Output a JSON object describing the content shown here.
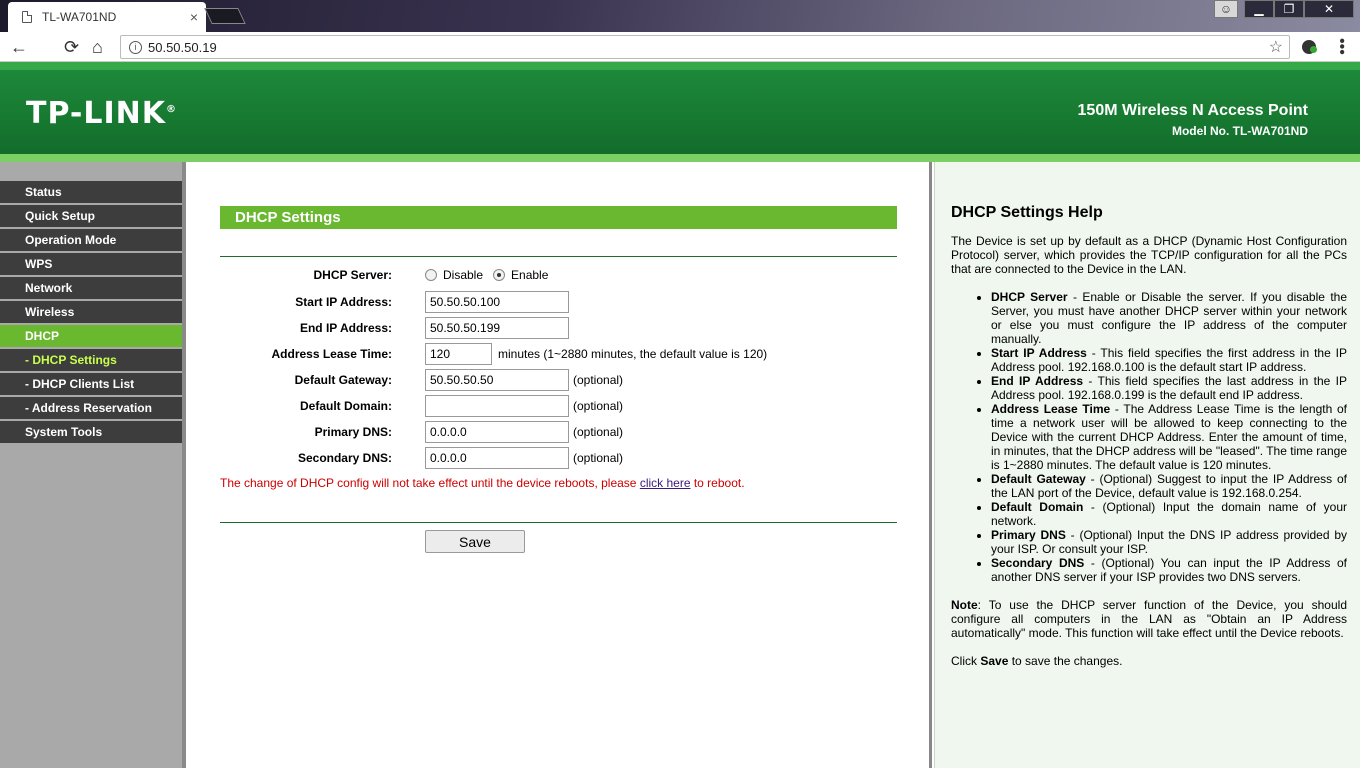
{
  "browser": {
    "tab_title": "TL-WA701ND",
    "tab_close": "×",
    "url": "50.50.50.19",
    "back_glyph": "←",
    "reload_glyph": "⟳",
    "home_glyph": "⌂",
    "star_glyph": "☆",
    "info_glyph": "i",
    "menu_glyph": "⋮",
    "min_glyph": "▁",
    "max_glyph": "❐",
    "close_glyph": "✕",
    "user_glyph": "👤"
  },
  "banner": {
    "logo": "TP-LINK",
    "logo_mark": "®",
    "product_title": "150M Wireless N Access Point",
    "model": "Model No. TL-WA701ND"
  },
  "menu": [
    {
      "label": "Status"
    },
    {
      "label": "Quick Setup"
    },
    {
      "label": "Operation Mode"
    },
    {
      "label": "WPS"
    },
    {
      "label": "Network"
    },
    {
      "label": "Wireless"
    },
    {
      "label": "DHCP"
    },
    {
      "label": "- DHCP Settings"
    },
    {
      "label": "- DHCP Clients List"
    },
    {
      "label": "- Address Reservation"
    },
    {
      "label": "System Tools"
    }
  ],
  "form": {
    "header": "DHCP Settings",
    "dhcp_server": {
      "label": "DHCP Server:",
      "disable": "Disable",
      "enable": "Enable",
      "selected": "Enable"
    },
    "start_ip": {
      "label": "Start IP Address:",
      "value": "50.50.50.100"
    },
    "end_ip": {
      "label": "End IP Address:",
      "value": "50.50.50.199"
    },
    "lease": {
      "label": "Address Lease Time:",
      "value": "120",
      "hint": "minutes (1~2880 minutes, the default value is 120)"
    },
    "gateway": {
      "label": "Default Gateway:",
      "value": "50.50.50.50",
      "hint": "(optional)"
    },
    "domain": {
      "label": "Default Domain:",
      "value": "",
      "hint": "(optional)"
    },
    "dns1": {
      "label": "Primary DNS:",
      "value": "0.0.0.0",
      "hint": "(optional)"
    },
    "dns2": {
      "label": "Secondary DNS:",
      "value": "0.0.0.0",
      "hint": "(optional)"
    },
    "notice_before": "The change of DHCP config will not take effect until the device reboots, please ",
    "notice_link": "click here",
    "notice_after": " to reboot.",
    "save": "Save"
  },
  "help": {
    "title": "DHCP Settings Help",
    "intro": "The Device is set up by default as a DHCP (Dynamic Host Configuration Protocol) server, which provides the TCP/IP configuration for all the PCs that are connected to the Device in the LAN.",
    "items": [
      {
        "term": "DHCP Server",
        "text": " - Enable or Disable the server. If you disable the Server, you must have another DHCP server within your network or else you must configure the IP address of the computer manually."
      },
      {
        "term": "Start IP Address",
        "text": " - This field specifies the first address in the IP Address pool. 192.168.0.100 is the default start IP address."
      },
      {
        "term": "End IP Address",
        "text": " - This field specifies the last address in the IP Address pool. 192.168.0.199 is the default end IP address."
      },
      {
        "term": "Address Lease Time",
        "text": " - The Address Lease Time is the length of time a network user will be allowed to keep connecting to the Device with the current DHCP Address. Enter the amount of time, in minutes, that the DHCP address will be \"leased\". The time range is 1~2880 minutes. The default value is 120 minutes."
      },
      {
        "term": "Default Gateway",
        "text": " - (Optional) Suggest to input the IP Address of the LAN port of the Device, default value is 192.168.0.254."
      },
      {
        "term": "Default Domain",
        "text": " - (Optional) Input the domain name of your network."
      },
      {
        "term": "Primary DNS",
        "text": " - (Optional) Input the DNS IP address provided by your ISP. Or consult your ISP."
      },
      {
        "term": "Secondary DNS",
        "text": " - (Optional) You can input the IP Address of another DNS server if your ISP provides two DNS servers."
      }
    ],
    "note_label": "Note",
    "note_text": ": To use the DHCP server function of the Device, you should configure all computers in the LAN as \"Obtain an IP Address automatically\" mode. This function will take effect until the Device reboots.",
    "click_before": "Click ",
    "click_bold": "Save",
    "click_after": " to save the changes."
  }
}
